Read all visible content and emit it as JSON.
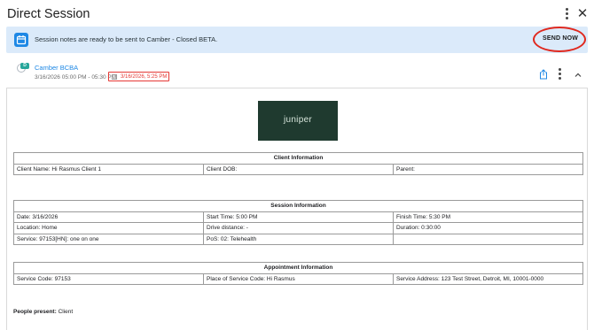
{
  "window": {
    "title": "Direct Session"
  },
  "banner": {
    "message": "Session notes are ready to be sent to Camber - Closed BETA.",
    "action_label": "SEND NOW"
  },
  "session": {
    "provider": "Camber BCBA",
    "avatar_badge": "D",
    "time_range": "3/16/2026 05:00 PM - 05:30 PM",
    "date_chip": "3/16/2026, 5:25 PM"
  },
  "document": {
    "logo_text": "juniper",
    "client_info": {
      "heading": "Client Information",
      "client_name": "Client Name: Hi Rasmus Client 1",
      "client_dob": "Client DOB:",
      "parent": "Parent:"
    },
    "session_info": {
      "heading": "Session Information",
      "date": "Date: 3/16/2026",
      "start_time": "Start Time: 5:00 PM",
      "finish_time": "Finish Time: 5:30 PM",
      "location": "Location: Home",
      "drive_distance": "Drive distance: -",
      "duration": "Duration: 0:30:00",
      "service": "Service: 97153[HN]: one on one",
      "pos": "PoS: 02: Telehealth",
      "empty": ""
    },
    "appointment_info": {
      "heading": "Appointment Information",
      "service_code": "Service Code: 97153",
      "place_of_service_code": "Place of Service Code: Hi Rasmus",
      "service_address": "Service Address: 123 Test Street, Detroit, MI, 10001-0000"
    },
    "people_present": {
      "label": "People present:",
      "value": "Client"
    }
  },
  "colors": {
    "accent_blue": "#1e88e5",
    "banner_bg": "#dbeafa",
    "highlight_red": "#e0281e",
    "logo_bg": "#1f3a2f"
  }
}
